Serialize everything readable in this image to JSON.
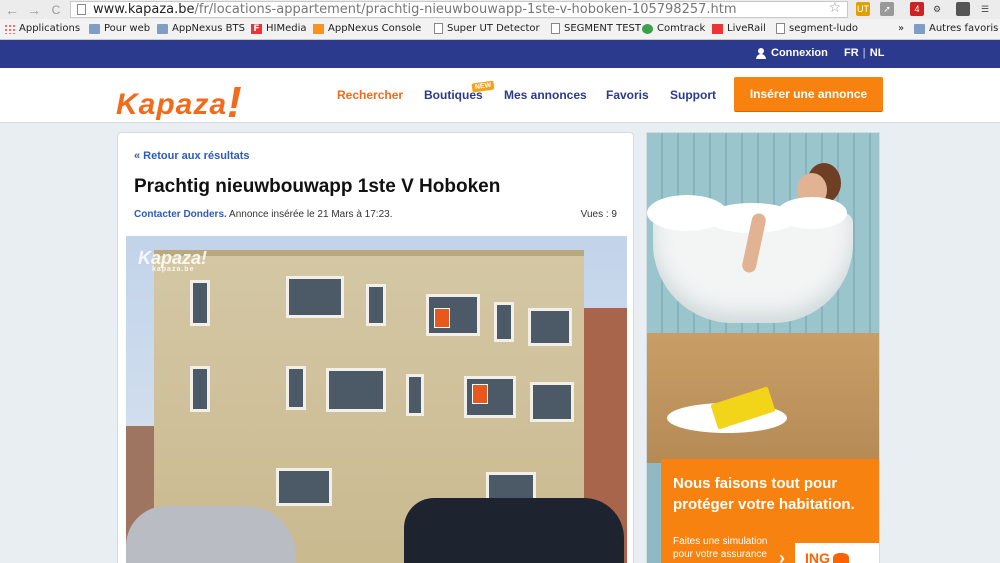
{
  "browser": {
    "back_glyph": "←",
    "forward_glyph": "→",
    "reload_glyph": "C",
    "url_domain": "www.kapaza.be",
    "url_path": "/fr/locations-appartement/prachtig-nieuwbouwapp-1ste-v-hoboken-105798257.htm",
    "star_glyph": "☆",
    "ext_badge_ut": "UT",
    "ext_badge_count": "4"
  },
  "bookmarks": [
    {
      "label": "Applications",
      "icon": "apps-grid-icon"
    },
    {
      "label": "Pour web",
      "icon": "folder-icon"
    },
    {
      "label": "AppNexus BTS",
      "icon": "folder-icon"
    },
    {
      "label": "HIMedia",
      "icon": "himedia-icon"
    },
    {
      "label": "AppNexus Console",
      "icon": "appnexus-icon"
    },
    {
      "label": "Super UT Detector",
      "icon": "page-icon"
    },
    {
      "label": "SEGMENT TEST",
      "icon": "page-icon"
    },
    {
      "label": "Comtrack",
      "icon": "comtrack-icon"
    },
    {
      "label": "LiveRail",
      "icon": "liverail-icon"
    },
    {
      "label": "segment-ludo",
      "icon": "page-icon"
    },
    {
      "label": "»",
      "icon": "overflow-icon"
    },
    {
      "label": "Autres favoris",
      "icon": "folder-icon"
    }
  ],
  "topbar": {
    "login_label": "Connexion",
    "lang_fr": "FR",
    "lang_sep": "|",
    "lang_nl": "NL"
  },
  "header": {
    "logo_text": "Kapaza",
    "logo_bang": "!",
    "nav": {
      "search": "Rechercher",
      "shops": "Boutiques",
      "my_ads": "Mes annonces",
      "favorites": "Favoris",
      "support": "Support"
    },
    "new_badge": "NEW",
    "cta_label": "Insérer une annonce"
  },
  "listing": {
    "back_label": "« Retour aux résultats",
    "title": "Prachtig nieuwbouwapp 1ste V Hoboken",
    "contact_label": "Contacter Donders.",
    "inserted_label": "Annonce insérée le 21 Mars à 17:23.",
    "views_label": "Vues : 9",
    "watermark_logo": "Kapaza!",
    "watermark_domain": "kapaza.be"
  },
  "ad": {
    "headline": "Nous faisons tout pour protéger votre habitation.",
    "sub_line1": "Faites une simulation",
    "sub_line2": "pour votre assurance",
    "brand": "ING",
    "arrow": "›"
  },
  "colors": {
    "brand_orange": "#f26a1b",
    "cta_orange": "#f7820f",
    "topbar_blue": "#2b3a8c",
    "link_blue": "#2b5cb8"
  }
}
